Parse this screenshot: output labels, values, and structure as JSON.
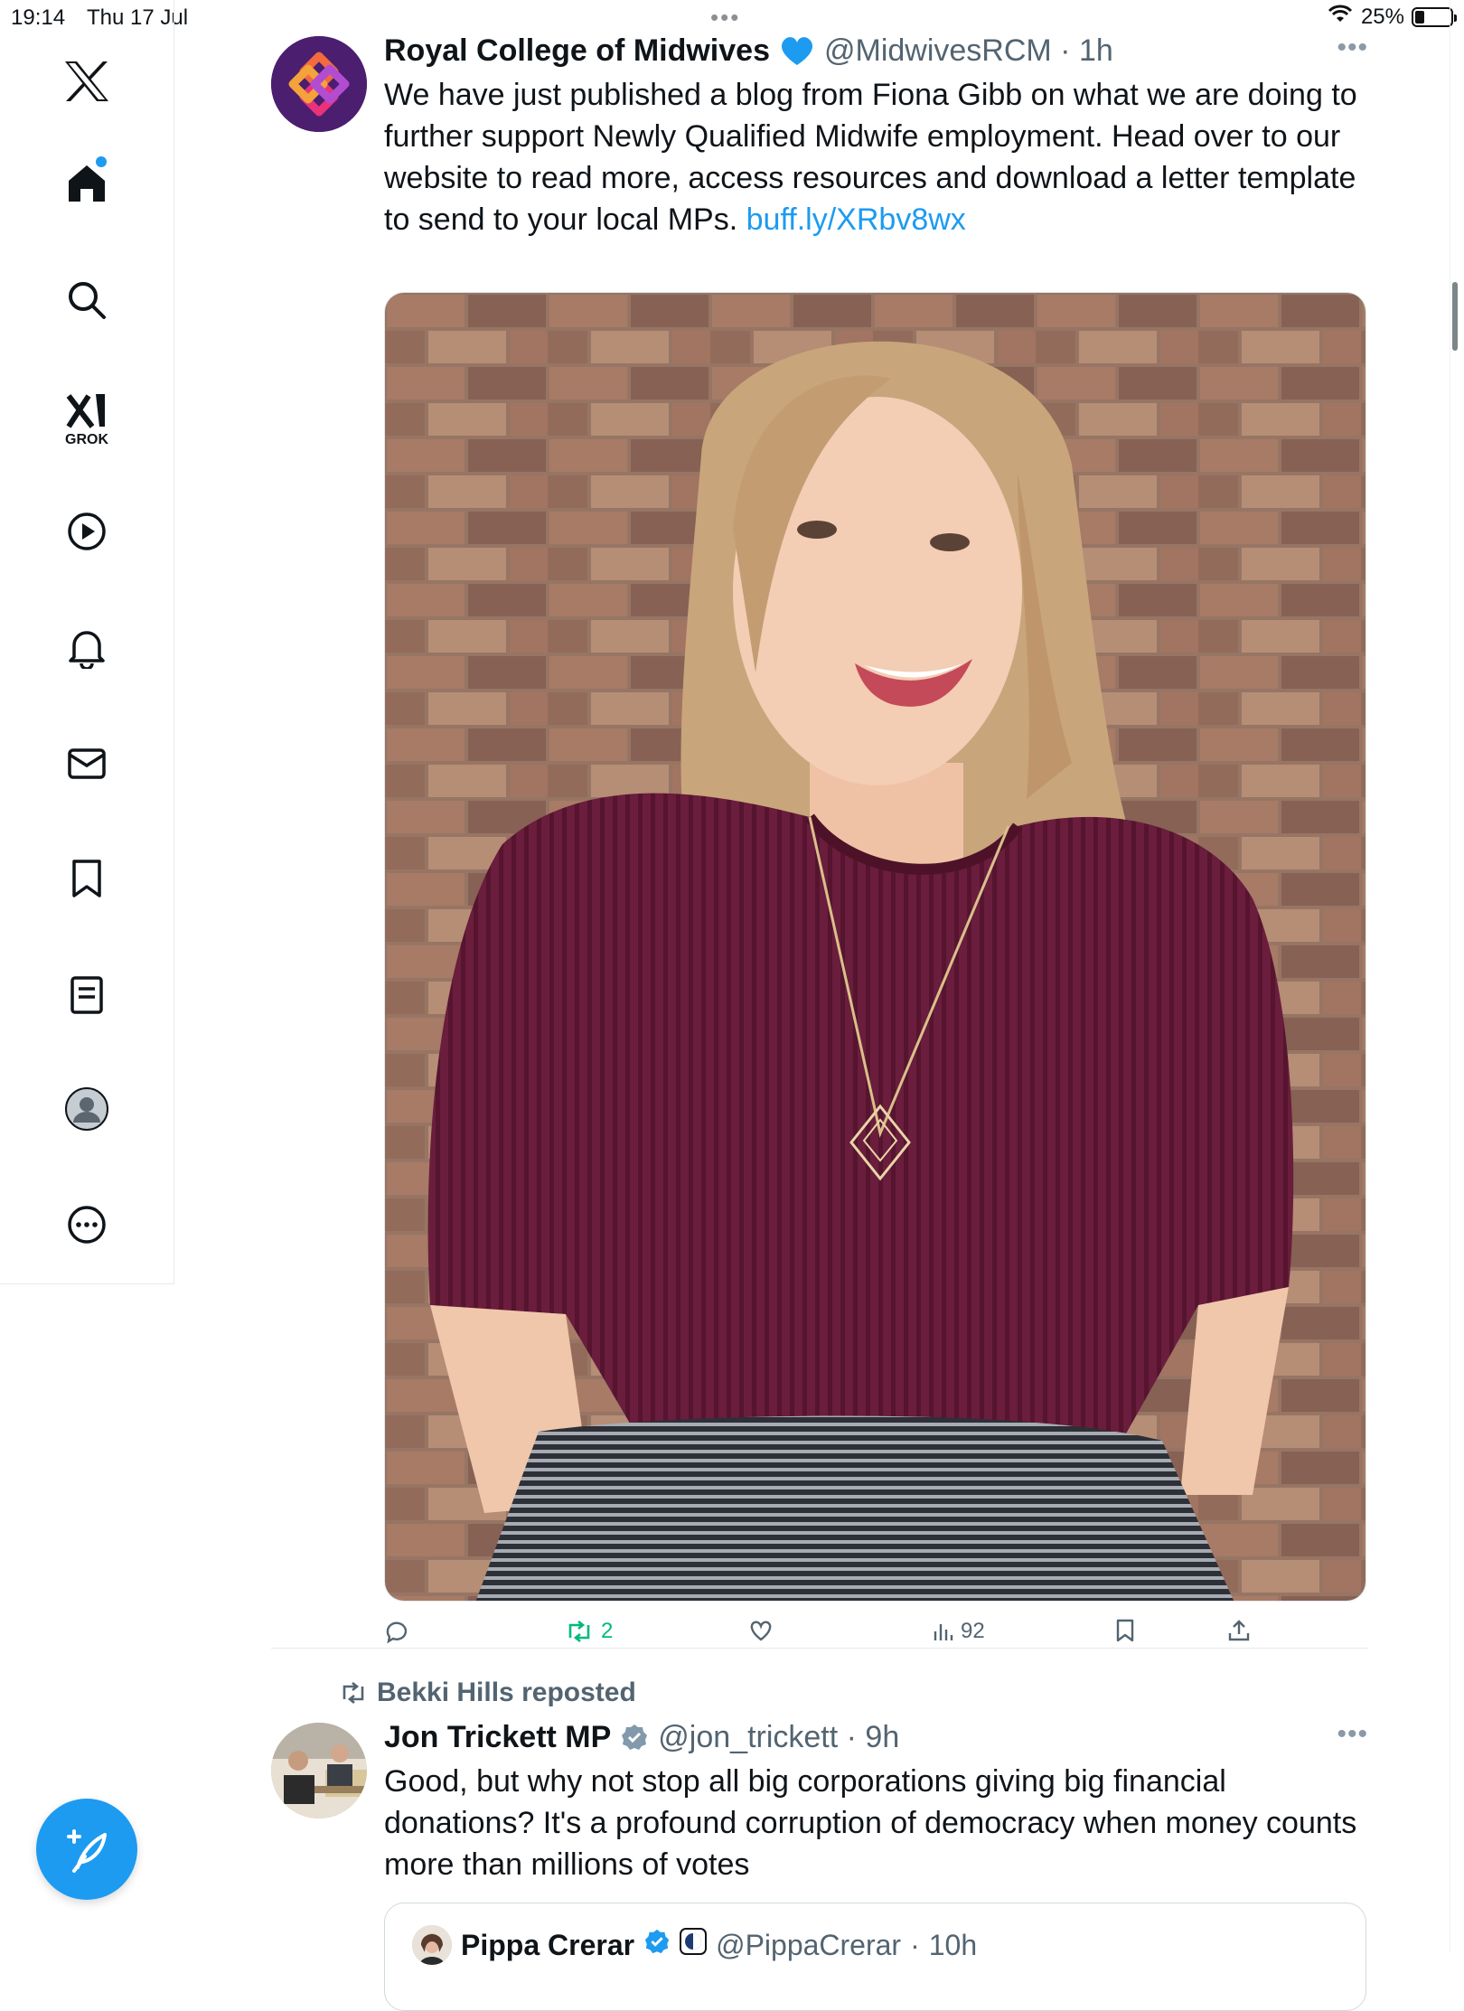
{
  "status_bar": {
    "time": "19:14",
    "date": "Thu 17 Jul",
    "battery": "25%",
    "battery_level": 0.25
  },
  "sidebar": {
    "items": [
      {
        "name": "x-logo",
        "label": ""
      },
      {
        "name": "home",
        "label": ""
      },
      {
        "name": "search",
        "label": ""
      },
      {
        "name": "grok",
        "label": "GROK"
      },
      {
        "name": "video",
        "label": ""
      },
      {
        "name": "notifications",
        "label": ""
      },
      {
        "name": "messages",
        "label": ""
      },
      {
        "name": "bookmarks",
        "label": ""
      },
      {
        "name": "lists",
        "label": ""
      },
      {
        "name": "profile",
        "label": ""
      },
      {
        "name": "more",
        "label": ""
      }
    ]
  },
  "tweets": [
    {
      "name": "Royal College of Midwives",
      "badge": "blue-heart",
      "handle": "@MidwivesRCM",
      "time": "1h",
      "text": "We have just published a blog from Fiona Gibb on what we are doing to further support Newly Qualified Midwife employment. Head over to our website to read more, access resources and download a letter template to send to your local MPs.",
      "link": "buff.ly/XRbv8wx",
      "actions": {
        "replies": "",
        "reposts": "2",
        "likes": "",
        "views": "92"
      }
    },
    {
      "repost_by": "Bekki Hills reposted",
      "name": "Jon Trickett MP",
      "badge": "verified-grey",
      "handle": "@jon_trickett",
      "time": "9h",
      "text": "Good, but why not stop all big corporations giving big financial donations? It's a profound corruption of democracy when money counts more than millions of votes",
      "quote": {
        "name": "Pippa Crerar",
        "handle": "@PippaCrerar",
        "time": "10h"
      }
    }
  ],
  "colors": {
    "accent": "#1d9bf0",
    "repost_green": "#00ba7c",
    "muted": "#536471"
  }
}
